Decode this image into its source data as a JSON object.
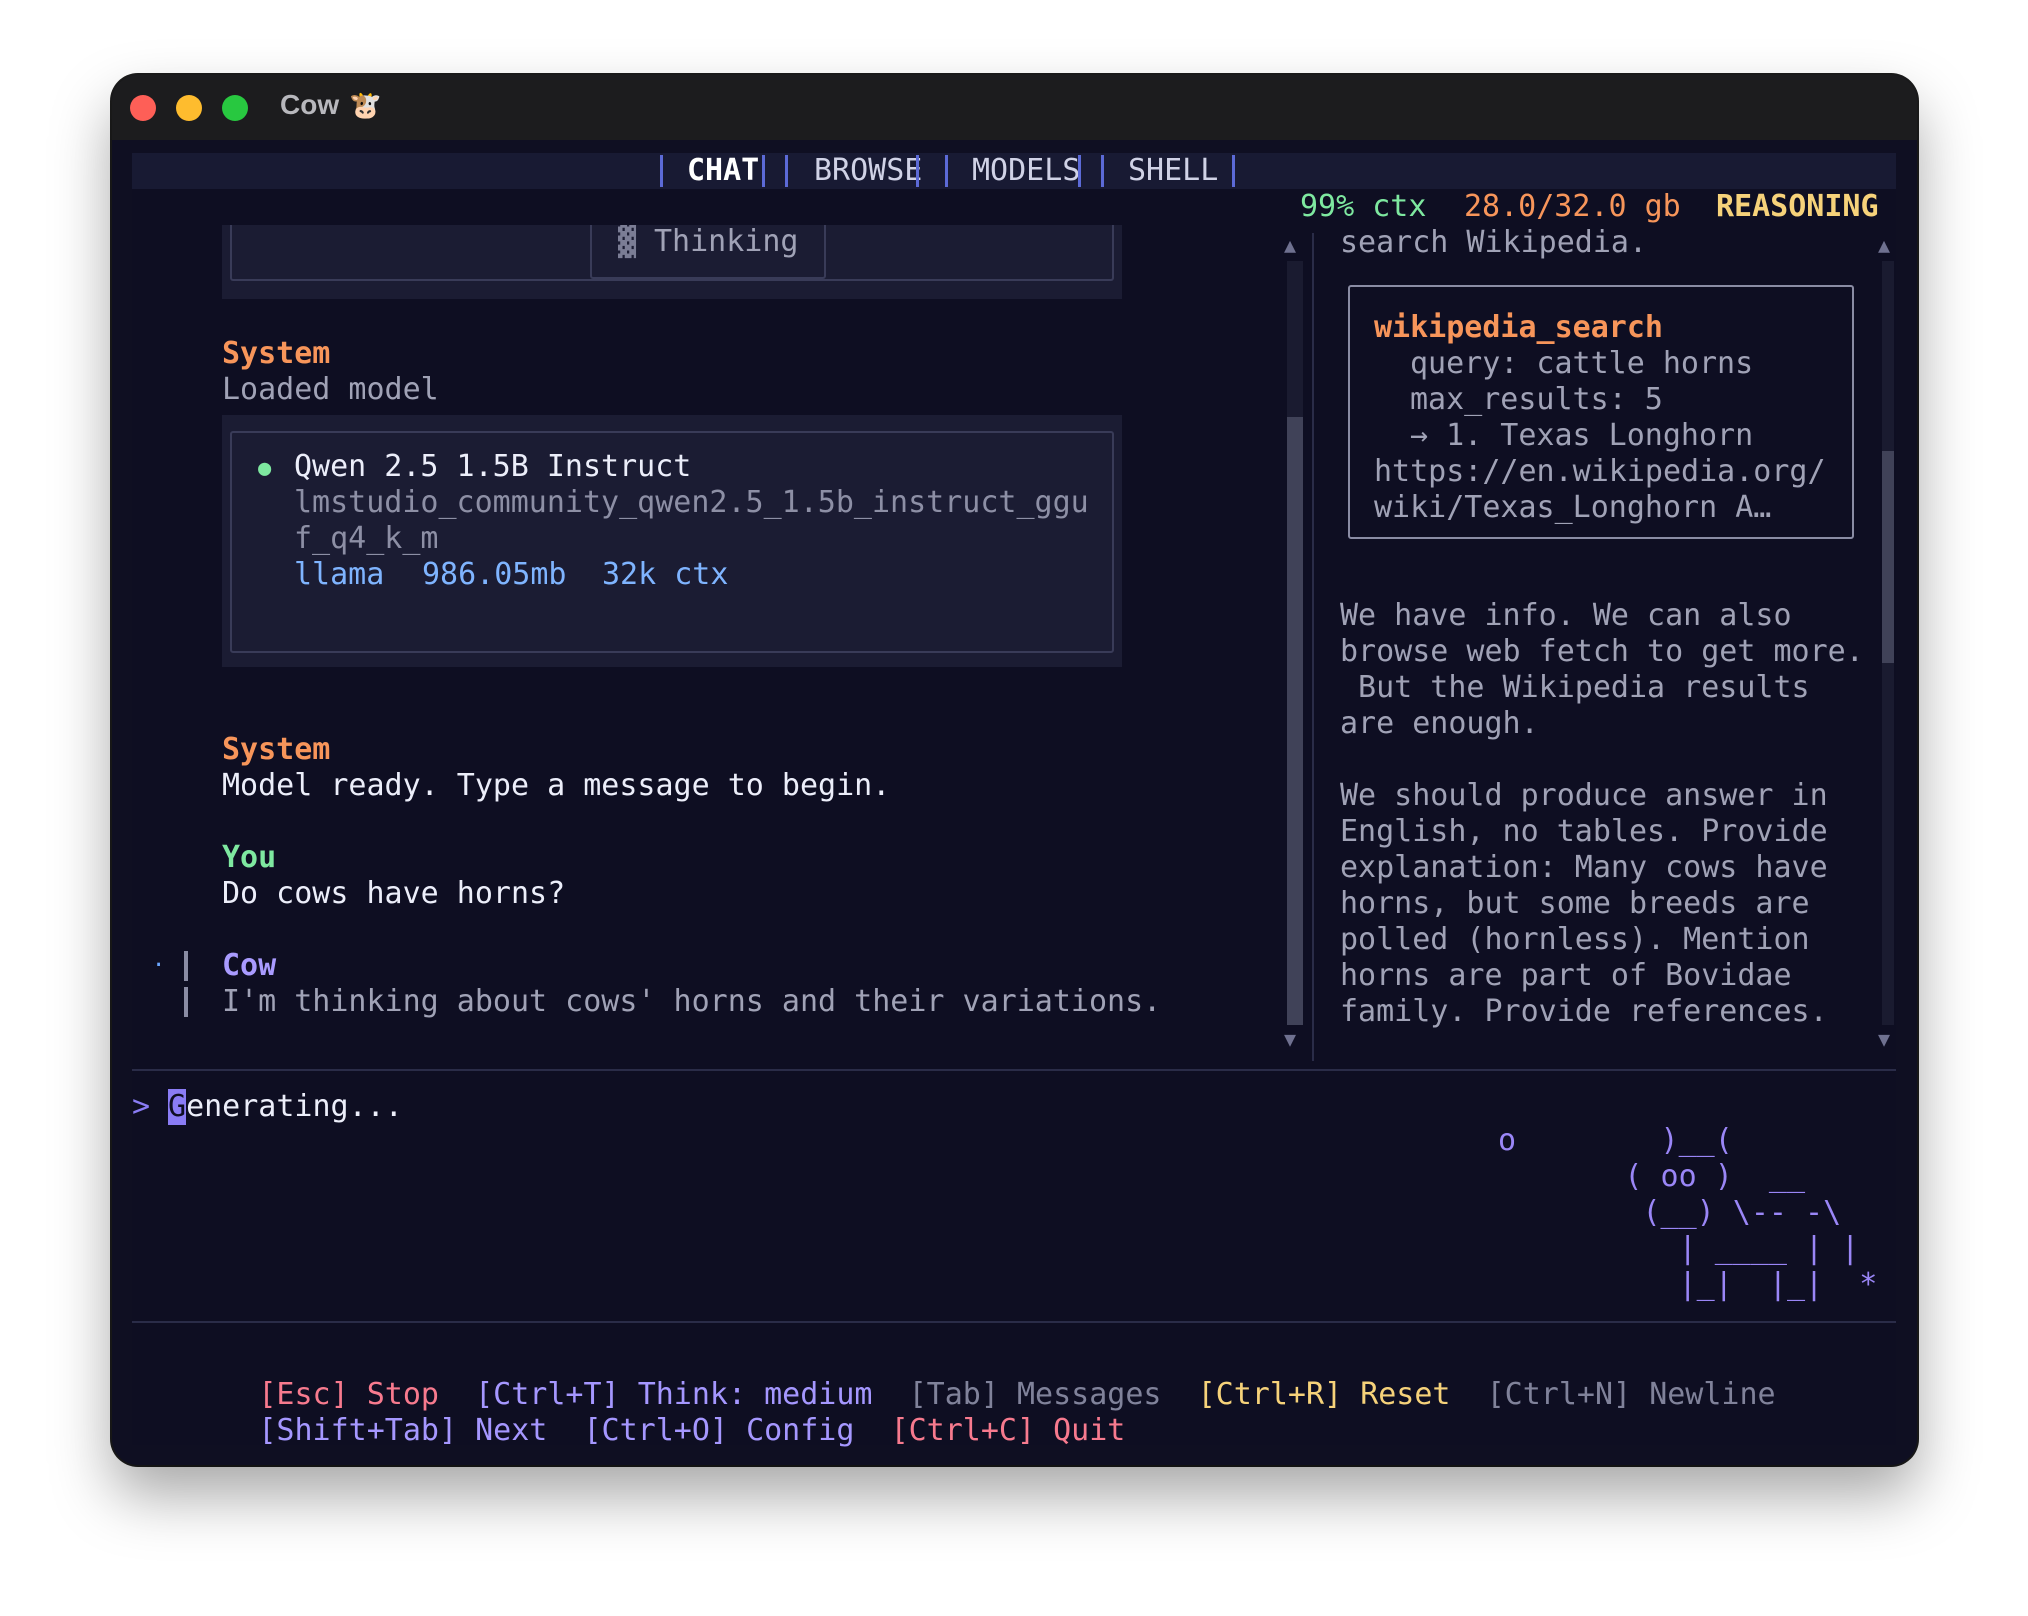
{
  "window": {
    "title": "Cow",
    "title_emoji": "🐮"
  },
  "tabs": [
    {
      "label": "CHAT",
      "active": true
    },
    {
      "label": "BROWSE",
      "active": false
    },
    {
      "label": "MODELS",
      "active": false
    },
    {
      "label": "SHELL",
      "active": false
    }
  ],
  "status": {
    "ctx": "99% ctx",
    "memory": "28.0/32.0 gb",
    "mode": "REASONING"
  },
  "chat": {
    "thinking_label": "Thinking",
    "messages": [
      {
        "role": "System",
        "text": "Loaded model"
      },
      {
        "role": "System",
        "text": "Model ready. Type a message to begin."
      },
      {
        "role": "You",
        "text": "Do cows have horns?"
      },
      {
        "role": "Cow",
        "text": "I'm thinking about cows' horns and their variations."
      }
    ],
    "model_card": {
      "bullet": "●",
      "name": "Qwen 2.5 1.5B Instruct",
      "id_line1": "lmstudio_community_qwen2.5_1.5b_instruct_ggu",
      "id_line2": "f_q4_k_m",
      "engine": "llama",
      "size": "986.05mb",
      "context": "32k ctx"
    },
    "cow_marker": "·"
  },
  "reasoning": {
    "top_line": "search Wikipedia.",
    "tool": {
      "name": "wikipedia_search",
      "query": "query: cattle horns",
      "max_results": "max_results: 5",
      "result": "→ 1. Texas Longhorn",
      "url1": "https://en.wikipedia.org/",
      "url2": "wiki/Texas_Longhorn A…"
    },
    "para1": [
      "We have info. We can also",
      "browse web fetch to get more.",
      " But the Wikipedia results",
      "are enough."
    ],
    "para2": [
      "We should produce answer in",
      "English, no tables. Provide",
      "explanation: Many cows have",
      "horns, but some breeds are",
      "polled (hornless). Mention",
      "horns are part of Bovidae",
      "family. Provide references."
    ]
  },
  "input": {
    "prompt": ">",
    "cursor_char": "G",
    "text": "enerating..."
  },
  "ascii_cow": [
    "o        )__(",
    "       ( oo )  __",
    "        (__) \\-- -\\",
    "          | ____ | |",
    "          |_|  |_|  *"
  ],
  "shortcuts": {
    "row1": [
      {
        "key": "[Esc]",
        "label": "Stop",
        "color": "#f77a8e"
      },
      {
        "key": "[Ctrl+T]",
        "label": "Think: medium",
        "color": "#a597ff"
      },
      {
        "key": "[Tab]",
        "label": "Messages",
        "color": "#80829a"
      },
      {
        "key": "[Ctrl+R]",
        "label": "Reset",
        "color": "#f6d27a"
      },
      {
        "key": "[Ctrl+N]",
        "label": "Newline",
        "color": "#80829a"
      }
    ],
    "row2": [
      {
        "key": "[Shift+Tab]",
        "label": "Next",
        "color": "#a597ff"
      },
      {
        "key": "[Ctrl+O]",
        "label": "Config",
        "color": "#a597ff"
      },
      {
        "key": "[Ctrl+C]",
        "label": "Quit",
        "color": "#f77a8e"
      }
    ]
  },
  "colors": {
    "status_ctx": "#7ee8a0",
    "status_memory": "#f7955a",
    "status_mode": "#f6d27a"
  }
}
